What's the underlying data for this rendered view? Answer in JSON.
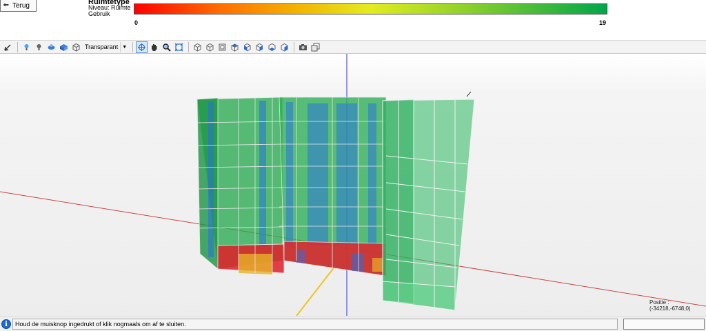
{
  "header": {
    "back_button_label": "Terug",
    "legend_title": "Ruimtetype",
    "legend_line1": "Niveau:  Ruimte",
    "legend_line2": "Gebruik",
    "scale_min": "0",
    "scale_max": "19",
    "gradient_colors": [
      "#ff0000",
      "#ff6d00",
      "#f3b600",
      "#e3ec1f",
      "#8ed12a",
      "#00a64b"
    ]
  },
  "toolbar": {
    "render_mode": "Transparant",
    "icons": [
      "select-arrow-icon",
      "light-icon",
      "lightbulb-icon",
      "shade-icon",
      "solid-icon",
      "wireframe-cube-icon",
      "rotate-icon",
      "pan-hand-icon",
      "zoom-icon",
      "zoom-extents-icon",
      "view-iso-icon",
      "view-front-icon",
      "view-back-icon",
      "view-top-icon",
      "view-left-icon",
      "view-right-icon",
      "view-bottom-icon",
      "view-persp-icon",
      "screenshot-icon",
      "copy-image-icon"
    ]
  },
  "viewport": {
    "position_readout": "Positie : (-34218,-6748,0)"
  },
  "statusbar": {
    "message": "Houd de muisknop ingedrukt of klik nogmaals om af te sluiten."
  }
}
